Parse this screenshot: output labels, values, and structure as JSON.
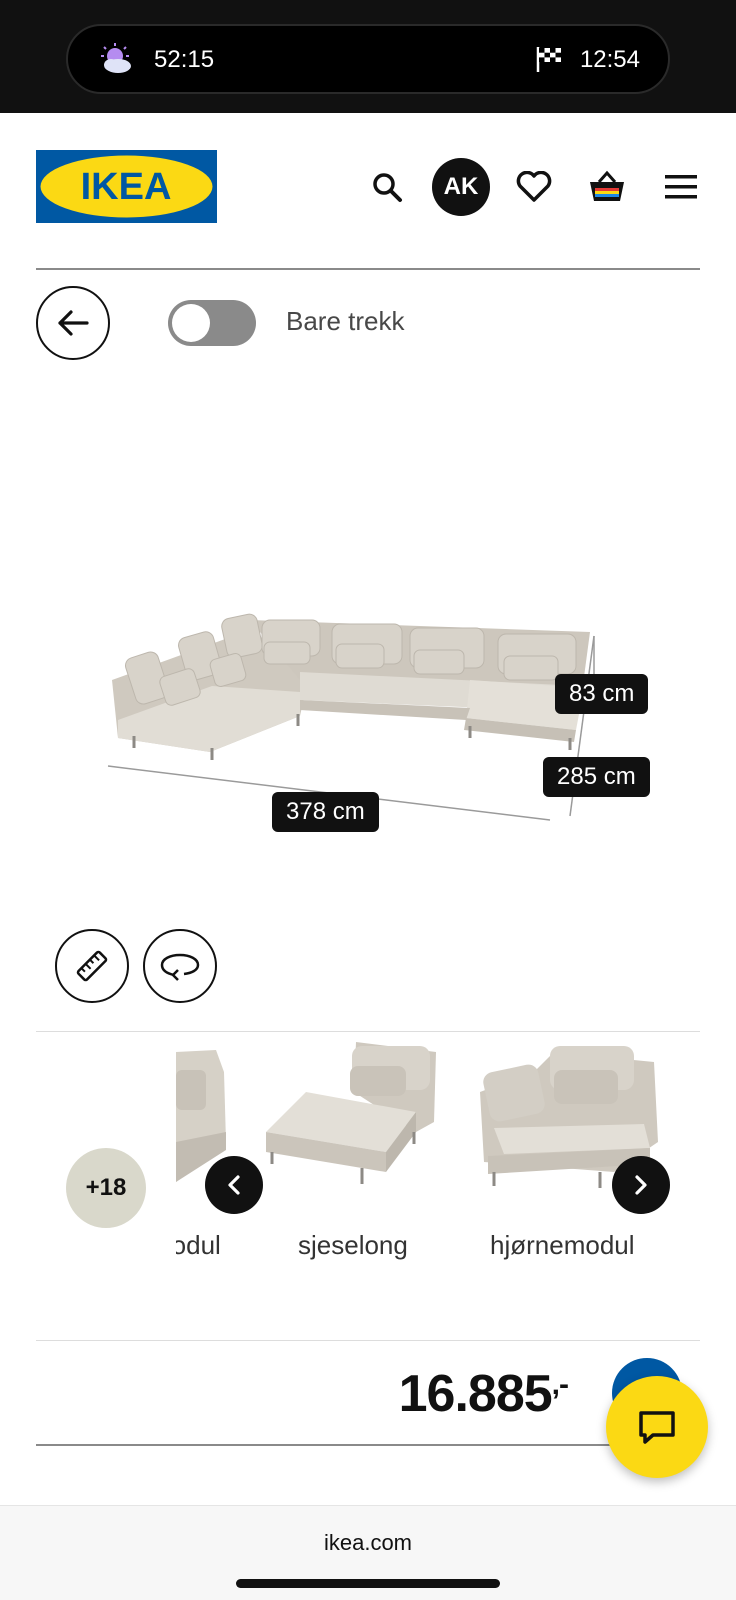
{
  "status_bar": {
    "left_time": "52:15",
    "right_time": "12:54"
  },
  "header": {
    "brand": "IKEA",
    "avatar_initials": "AK"
  },
  "controls": {
    "toggle_label": "Bare trekk",
    "toggle_on": false
  },
  "dimensions": {
    "height": "83 cm",
    "depth": "285 cm",
    "width": "378 cm"
  },
  "carousel": {
    "more_count": "+18",
    "items": [
      {
        "label": "modul"
      },
      {
        "label": "sjeselong"
      },
      {
        "label": "hjørnemodul"
      }
    ]
  },
  "price": {
    "amount": "16.885",
    "suffix": ",-"
  },
  "footer": {
    "url": "ikea.com"
  },
  "colors": {
    "ikea_blue": "#0058a3",
    "ikea_yellow": "#fbd914",
    "sofa": "#d6d1c7"
  }
}
